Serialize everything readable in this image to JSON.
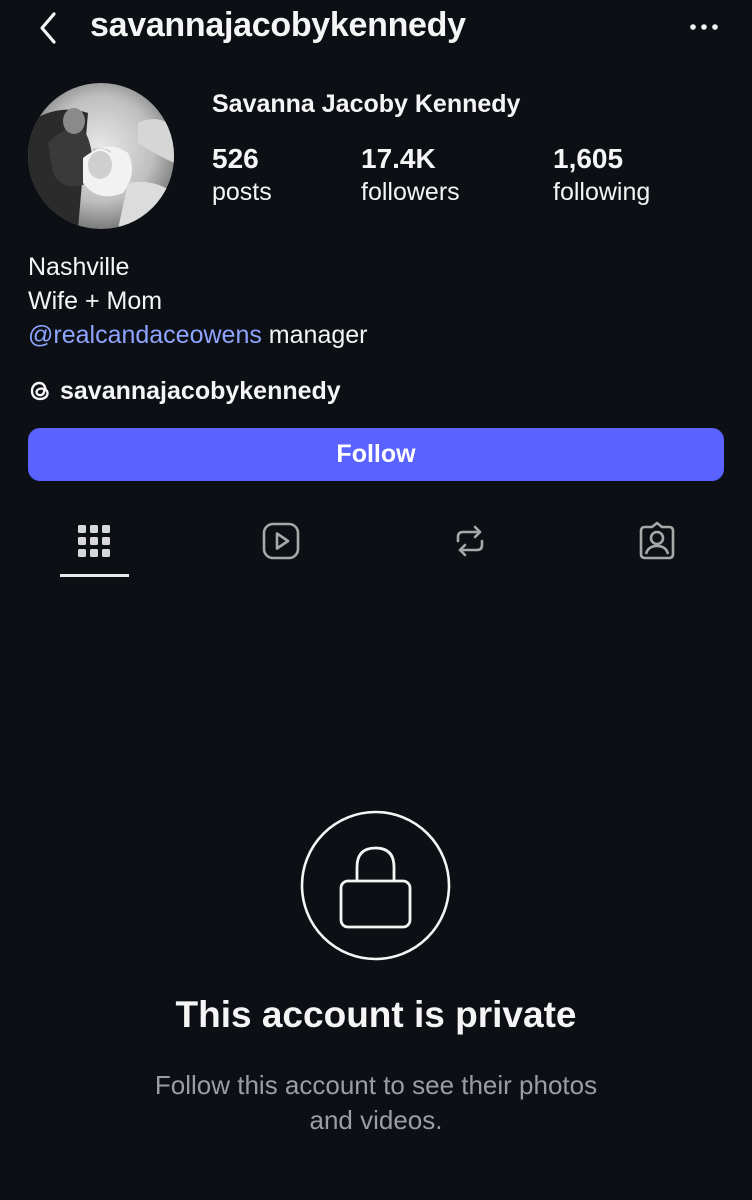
{
  "header": {
    "username": "savannajacobykennedy",
    "back_icon": "chevron-left-icon",
    "more_icon": "ellipsis-icon"
  },
  "profile": {
    "display_name": "Savanna Jacoby Kennedy",
    "stats": {
      "posts": {
        "value": "526",
        "label": "posts"
      },
      "followers": {
        "value": "17.4K",
        "label": "followers"
      },
      "following": {
        "value": "1,605",
        "label": "following"
      }
    },
    "bio": {
      "line1": "Nashville",
      "line2": "Wife + Mom",
      "mention": "@realcandaceowens",
      "mention_suffix": " manager"
    },
    "threads": {
      "icon": "threads-icon",
      "handle": "savannajacobykennedy"
    }
  },
  "actions": {
    "follow_label": "Follow"
  },
  "tabs": [
    {
      "name": "posts-grid",
      "icon": "grid-icon",
      "active": true
    },
    {
      "name": "reels",
      "icon": "reels-icon",
      "active": false
    },
    {
      "name": "reposts",
      "icon": "repost-icon",
      "active": false
    },
    {
      "name": "tagged",
      "icon": "tagged-icon",
      "active": false
    }
  ],
  "private": {
    "icon": "lock-icon",
    "title": "This account is private",
    "subtitle_line1": "Follow this account to see their photos",
    "subtitle_line2": "and videos."
  },
  "colors": {
    "background": "#0c1014",
    "accent": "#5a62ff",
    "link": "#8fa4ff",
    "muted_text": "#9a9ea3"
  }
}
